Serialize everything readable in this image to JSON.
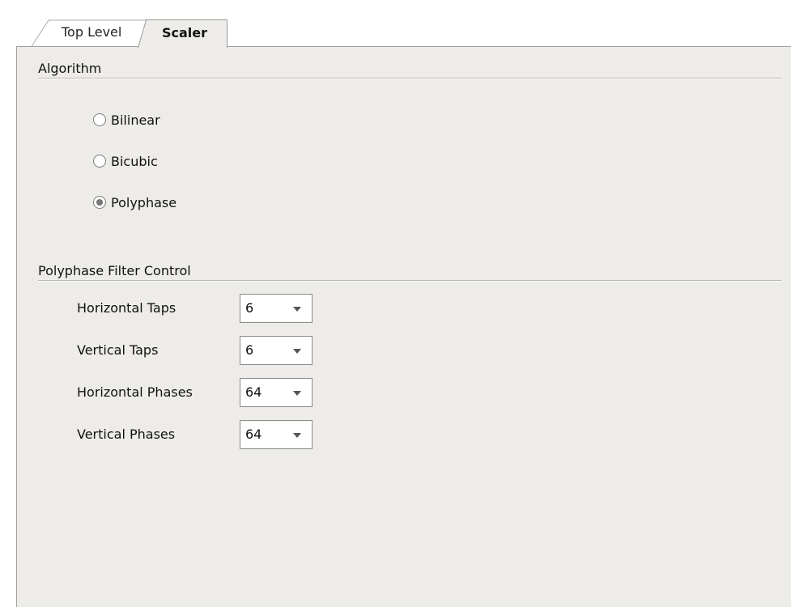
{
  "tabs": [
    {
      "label": "Top Level",
      "selected": false
    },
    {
      "label": "Scaler",
      "selected": true
    }
  ],
  "algorithm": {
    "title": "Algorithm",
    "options": [
      {
        "label": "Bilinear",
        "checked": false
      },
      {
        "label": "Bicubic",
        "checked": false
      },
      {
        "label": "Polyphase",
        "checked": true
      }
    ]
  },
  "polyphase": {
    "title": "Polyphase Filter Control",
    "fields": [
      {
        "label": "Horizontal Taps",
        "value": "6"
      },
      {
        "label": "Vertical Taps",
        "value": "6"
      },
      {
        "label": "Horizontal Phases",
        "value": "64"
      },
      {
        "label": "Vertical Phases",
        "value": "64"
      }
    ]
  },
  "colors": {
    "panel_background": "#eeece9",
    "border": "#a0a0a0"
  }
}
